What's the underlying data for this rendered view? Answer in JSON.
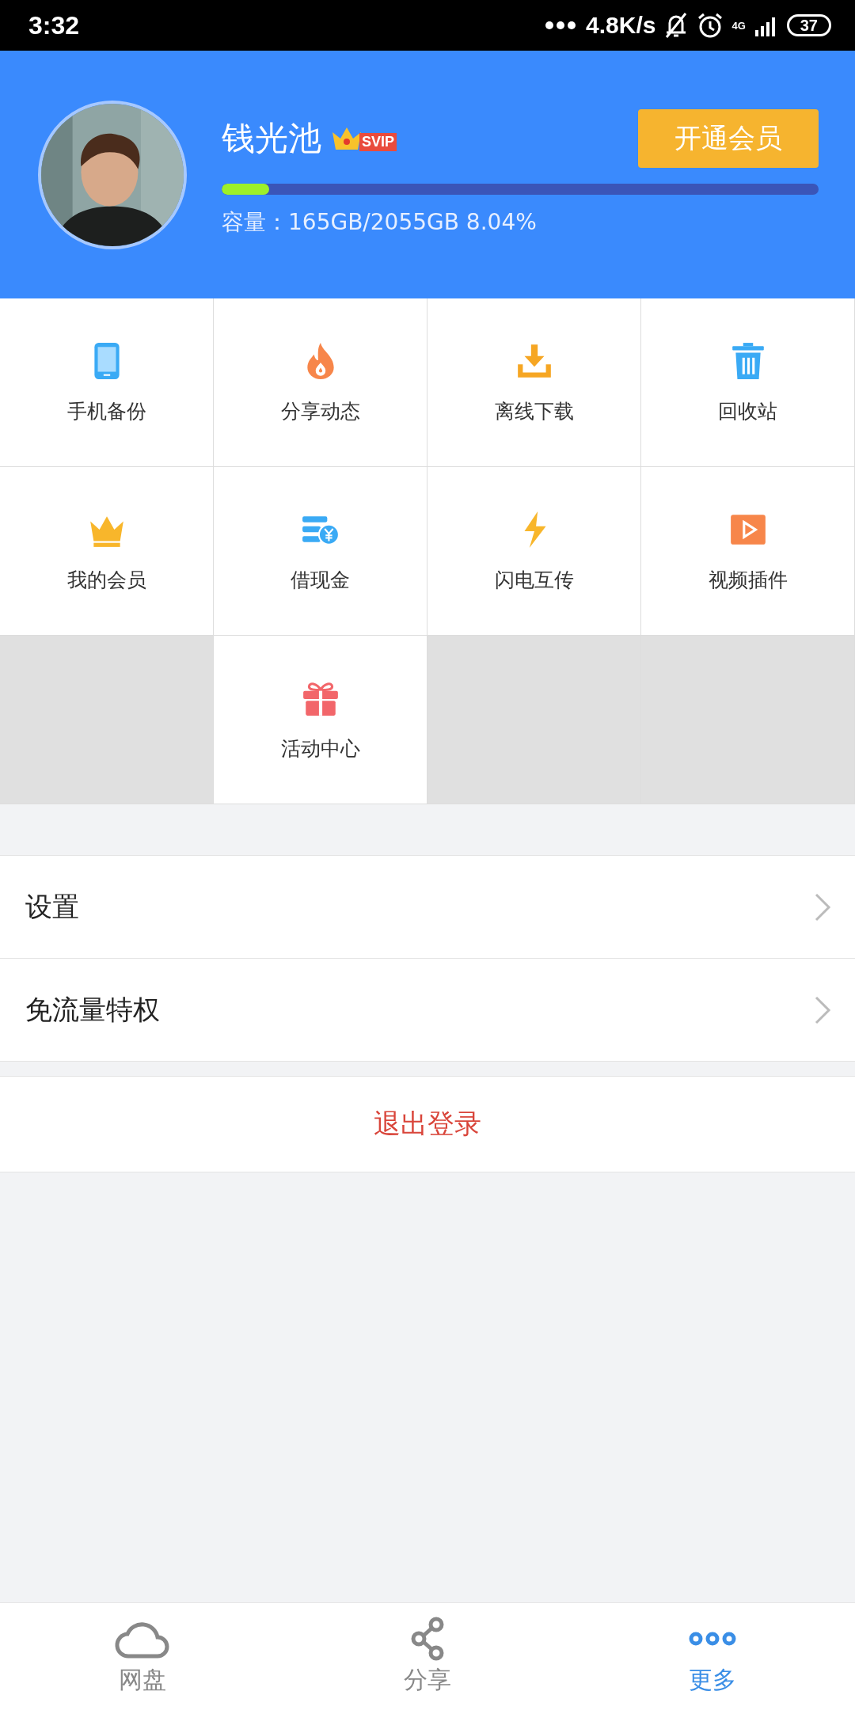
{
  "status_bar": {
    "time": "3:32",
    "net_speed": "4.8K/s",
    "network": "4G",
    "battery": "37"
  },
  "profile": {
    "name": "钱光池",
    "badge": "SVIP",
    "storage": {
      "level": 0.08
    },
    "capacity": "容量：165GB/2055GB 8.04%",
    "button": "开通会员"
  },
  "grid": [
    {
      "kind": "phone",
      "label": "手机备份"
    },
    {
      "kind": "flame",
      "label": "分享动态"
    },
    {
      "kind": "download",
      "label": "离线下载"
    },
    {
      "kind": "trash",
      "label": "回收站"
    },
    {
      "kind": "crown",
      "label": "我的会员"
    },
    {
      "kind": "money",
      "label": "借现金"
    },
    {
      "kind": "bolt",
      "label": "闪电互传"
    },
    {
      "kind": "video",
      "label": "视频插件"
    },
    {
      "kind": "empty"
    },
    {
      "kind": "gift",
      "label": "活动中心"
    },
    {
      "kind": "empty"
    },
    {
      "kind": "empty"
    }
  ],
  "menu": [
    {
      "label": "设置"
    },
    {
      "label": "免流量特权"
    }
  ],
  "logout": "退出登录",
  "tabs": [
    {
      "kind": "cloud",
      "label": "网盘",
      "selected": false
    },
    {
      "kind": "share",
      "label": "分享",
      "selected": false
    },
    {
      "kind": "more",
      "label": "更多",
      "selected": true
    }
  ]
}
